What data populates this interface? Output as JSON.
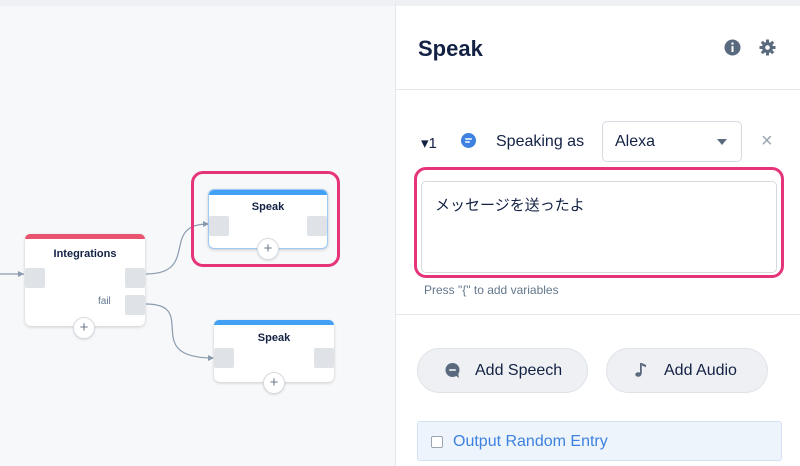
{
  "canvas": {
    "blocks": [
      {
        "title": "Integrations",
        "bar_color": "#e8546e",
        "fail_label": "fail"
      },
      {
        "title": "Speak",
        "bar_color": "#42a1f5"
      },
      {
        "title": "Speak",
        "bar_color": "#42a1f5"
      }
    ],
    "plus_glyph": "+",
    "highlight_color": "#e5347a"
  },
  "panel": {
    "title": "Speak",
    "icons": {
      "info": "info-icon",
      "settings": "gear-icon"
    },
    "speak_item": {
      "index": "1",
      "toggle_glyph": "▾",
      "speaking_label": "Speaking as",
      "voice": "Alexa",
      "remove_glyph": "×",
      "text": "メッセージを送ったよ",
      "hint": "Press \"{\" to add variables"
    },
    "buttons": {
      "add_speech": "Add Speech",
      "add_audio": "Add Audio"
    },
    "random": {
      "label": "Output Random Entry",
      "checked": false
    }
  },
  "colors": {
    "speak_bar": "#42a1f5",
    "integrations_bar": "#e8546e",
    "highlight": "#e5347a",
    "link_blue": "#3d82e0"
  }
}
